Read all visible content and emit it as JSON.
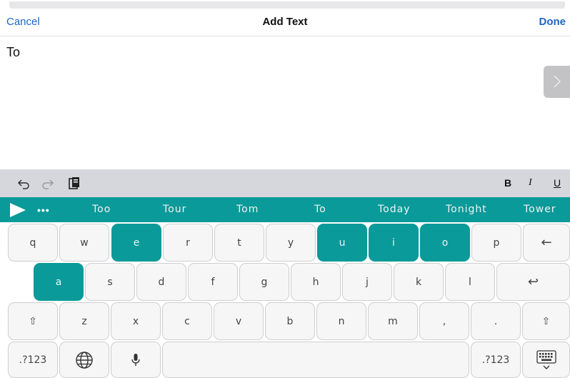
{
  "nav": {
    "cancel": "Cancel",
    "title": "Add Text",
    "done": "Done"
  },
  "editor": {
    "text": "To"
  },
  "toolbar": {
    "undo_icon": "undo-icon",
    "redo_icon": "redo-icon",
    "paste_icon": "clipboard-icon",
    "bold": "B",
    "italic": "I",
    "underline": "U"
  },
  "suggestions": {
    "dots": "•••",
    "items": [
      "Too",
      "Tour",
      "Tom",
      "To",
      "Today",
      "Tonight",
      "Tower"
    ]
  },
  "keys": {
    "row1": [
      "q",
      "w",
      "e",
      "r",
      "t",
      "y",
      "u",
      "i",
      "o",
      "p"
    ],
    "row2": [
      "a",
      "s",
      "d",
      "f",
      "g",
      "h",
      "j",
      "k",
      "l"
    ],
    "row3": [
      "z",
      "x",
      "c",
      "v",
      "b",
      "n",
      "m",
      ",",
      "."
    ],
    "numbers": ".?123",
    "backspace": "←",
    "return": "↩",
    "shift": "⇧"
  },
  "highlighted_keys": [
    "e",
    "u",
    "i",
    "o",
    "a"
  ],
  "colors": {
    "accent": "#0a9a99",
    "link": "#1f66c4"
  }
}
